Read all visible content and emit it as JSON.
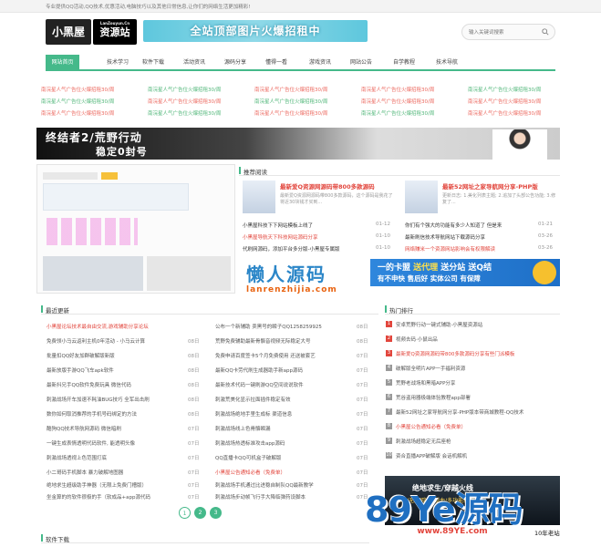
{
  "topbar": {
    "text": "专业提供QQ活动,QQ技术,优惠活动,电脑技巧以及其他日常信息,让你们的网络生活更加精彩!"
  },
  "logo": {
    "main": "小黑屋",
    "side": "资源站",
    "side_small": "LanZouyun.Cn"
  },
  "banner": {
    "text": "全站顶部图片火爆招租中"
  },
  "search": {
    "placeholder": "输入关键词搜索"
  },
  "nav": {
    "items": [
      "网站首页",
      "技术学习",
      "软件下载",
      "活动资讯",
      "源码分享",
      "懂得一看",
      "游戏资讯",
      "网站公告",
      "自学教程",
      "技术导航"
    ]
  },
  "ads": {
    "text": "南浣星人气广告位火爆招租30/周"
  },
  "hero": {
    "line1": "终结者2/荒野行动",
    "line2": "稳定0封号"
  },
  "recommend": {
    "title": "推荐阅读",
    "left_headline": "最新爱Q资源网源码带800多款源码",
    "left_desc": "最新爱Q资源网源码带800多款源码，这个源码是我花了将近30块钱才买到...",
    "right_headline": "最新52网址之家导航网分享-PHP版",
    "right_desc": "更新日志: 1.美化列表主题; 2.追加了头部公告功能; 3.修复了..."
  },
  "rec_list_left": [
    {
      "t": "小黑屋科技下下网站模板上线了",
      "d": "01-12",
      "red": false
    },
    {
      "t": "小黑屋导航天下科技网站源码分享",
      "d": "01-10",
      "red": true
    },
    {
      "t": "代刷网源码，添加平台多分版-小黑屋专属版",
      "d": "01-10",
      "red": false
    }
  ],
  "rec_list_right": [
    {
      "t": "你们有个强大的功能有多少人知道了 但是来",
      "d": "01-21",
      "red": false
    },
    {
      "t": "最新刷信技术导航网站下载源码分享",
      "d": "03-26",
      "red": false
    },
    {
      "t": "网络赚米一个资源网站影响会有权限解读",
      "d": "03-26",
      "red": true
    }
  ],
  "lazy": {
    "cn": "懒人源码",
    "en": "lanrenzhijia.com"
  },
  "qqban": {
    "pre": "一的卡盟 ",
    "mid": "送代理",
    "post": " 送分站 送Q结",
    "line2": "有不申快 售后好 实体公司 有保障"
  },
  "latest": {
    "title": "最近更新",
    "left": [
      {
        "t": "小黑屋论坛技术最自由交流,游戏辅助分享论坛",
        "d": "",
        "red": true
      },
      {
        "t": "免费领小马云返利主机0年活动 - 小马云计算",
        "d": "08日"
      },
      {
        "t": "批量扣QQ好友加群破解版新版",
        "d": "08日"
      },
      {
        "t": "最新放版手游QQ飞车apk软件",
        "d": "08日"
      },
      {
        "t": "最新抖兄手QQ软件免费玩具 微信代码",
        "d": "08日"
      },
      {
        "t": "刺激战场开车加速不耗油BUG技巧 全军出击刷",
        "d": "08日"
      },
      {
        "t": "数你如何取消推荐的手机号码绑定的方法",
        "d": "08日"
      },
      {
        "t": "酷狗QQ技术导航网源码 微信暗刷",
        "d": "07日"
      },
      {
        "t": "一键生成表情透明代码软件, 能透明头像",
        "d": "07日"
      },
      {
        "t": "刺激战场透视上色范围打底",
        "d": "07日"
      },
      {
        "t": "小二哥码手机脚本 暴力破解地图器",
        "d": "07日"
      },
      {
        "t": "绝地求生超级助手神器（无限上免费门槽版）",
        "d": "07日"
      },
      {
        "t": "坐金算的的软件很极的手（软成品+app源代码",
        "d": "07日"
      }
    ],
    "right": [
      {
        "t": "公布一个新辅助 卖黑号的瞬子QQ1258259925",
        "d": "08日"
      },
      {
        "t": "荒野免费辅助最新骨骼音视频无际稳定大号",
        "d": "08日"
      },
      {
        "t": "免费申请百度签卡5个月免费使用 还送被套艺",
        "d": "07日"
      },
      {
        "t": "最新QQ卡劳代刷生成器助手新app源码",
        "d": "07日"
      },
      {
        "t": "最新技术代码一键刷游QQ空间说说软件",
        "d": "07日"
      },
      {
        "t": "刺激荒美化显示拉面插件稳定有效",
        "d": "07日"
      },
      {
        "t": "刺激战场绝地手里生成标 渠道信息",
        "d": "07日"
      },
      {
        "t": "刺激战场线上色骨骼瞬漏",
        "d": "07日"
      },
      {
        "t": "刺激战场热透标准攻击app源码",
        "d": "07日"
      },
      {
        "t": "QQ直播卡QQ可机盒子破解版",
        "d": "07日"
      },
      {
        "t": "小黑屋公告通知必看（免费单）",
        "d": "07日",
        "red": true
      },
      {
        "t": "刺激战场手机通过比进稳自制队QQ最新教学",
        "d": "07日"
      },
      {
        "t": "刺激战场步动帧飞行手大降临弹药设脚本",
        "d": "07日"
      }
    ]
  },
  "hot": {
    "title": "热门排行",
    "items": [
      {
        "t": "安卓荒野行动一键式辅助·小黑屋资源站",
        "red": false
      },
      {
        "t": "视频去码·小鼠出品",
        "red": false
      },
      {
        "t": "最新爱Q资源网源码带800多款源码分享有些门派模板",
        "red": true
      },
      {
        "t": "破解版全明片APP一手福利资源",
        "red": false
      },
      {
        "t": "荒野老战场和黑暗APP分享",
        "red": false
      },
      {
        "t": "荒谷盗用器极端体验教程app部署",
        "red": false
      },
      {
        "t": "最新52网址之家导航网分享-PHP版本带商城教程-QQ技术",
        "red": false
      },
      {
        "t": "小黑屋公告通知必看（免费单）",
        "red": true
      },
      {
        "t": "刺激战场超稳定无后座枪",
        "red": false
      },
      {
        "t": "资合直播APP破解版 会话机解机",
        "red": false
      }
    ]
  },
  "game": {
    "t1": "绝地求生/穿越火线",
    "t2": "自瞄/无后/隐身/锁血/多功能辅助/上"
  },
  "pager": {
    "pages": [
      "1",
      "2",
      "3"
    ]
  },
  "watermark": {
    "big": "89Ye源码",
    "url": "www.89YE.com",
    "tag": "10年老站"
  },
  "soft": {
    "title": "软件下载"
  },
  "colors": {
    "accent": "#45b98a",
    "red": "#e2463d",
    "blue": "#1f6fc1"
  }
}
